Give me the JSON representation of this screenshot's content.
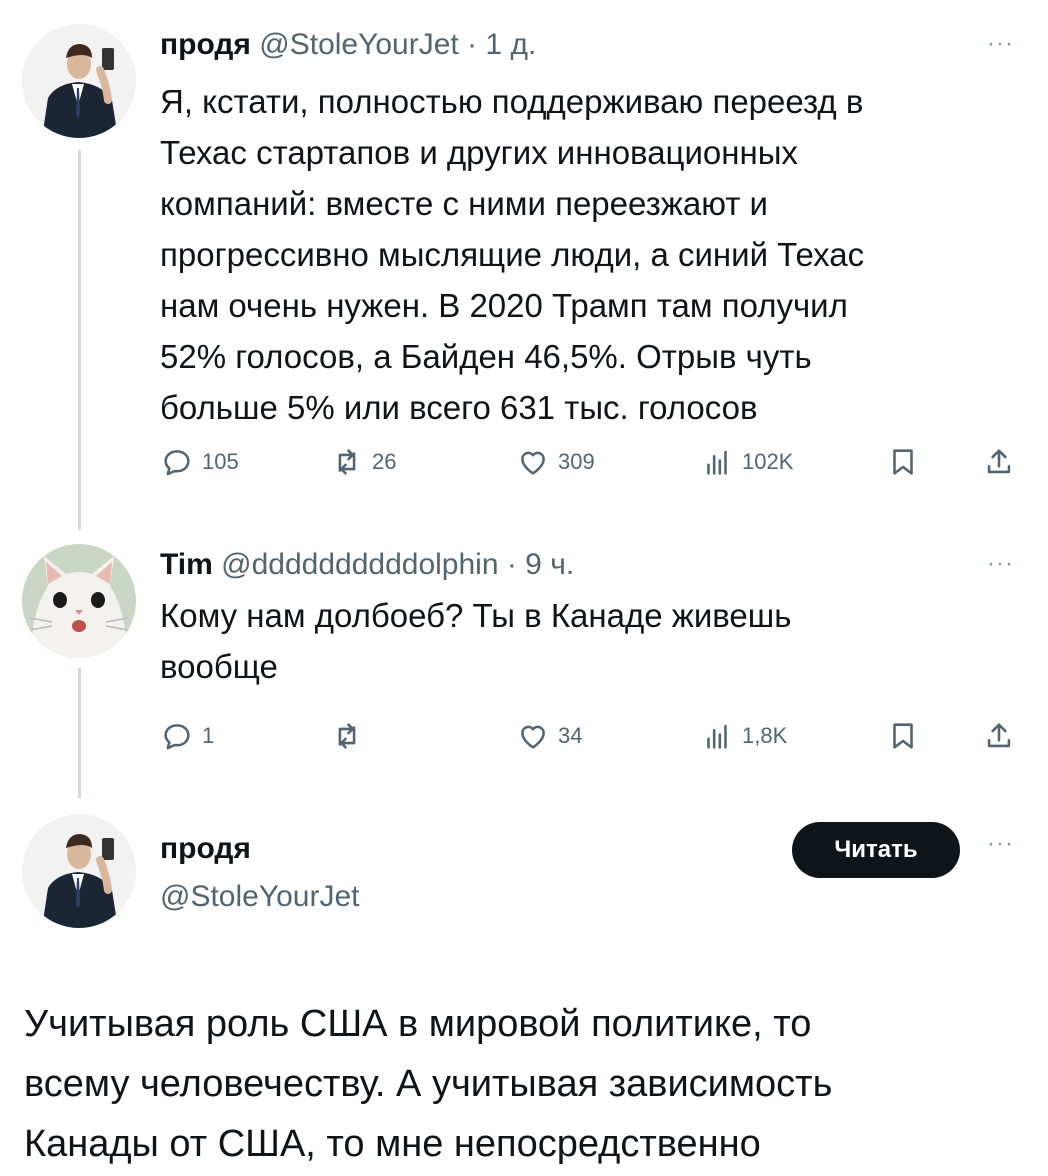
{
  "tweet1": {
    "name": "продя",
    "handle": "@StoleYourJet",
    "time": "· 1 д.",
    "more": "···",
    "lines": [
      "Я, кстати, полностью поддерживаю переезд в",
      "Техас стартапов и других инновационных",
      "компаний: вместе с ними переезжают и",
      "прогрессивно мыслящие люди, а синий Техас",
      "нам очень нужен. В 2020 Трамп там получил",
      "52% голосов, а Байден 46,5%. Отрыв чуть",
      "больше 5% или всего 631 тыс. голосов"
    ],
    "actions": {
      "replies": "105",
      "reposts": "26",
      "likes": "309",
      "views": "102K"
    },
    "avatar_icon": "person-photo-avatar"
  },
  "tweet2": {
    "name": "Tim",
    "handle": "@ddddddddddolphin",
    "time": "· 9 ч.",
    "more": "···",
    "lines": [
      "Кому нам долбоеб? Ты в Канаде живешь",
      "вообще"
    ],
    "actions": {
      "replies": "1",
      "reposts": "",
      "likes": "34",
      "views": "1,8K"
    },
    "avatar_icon": "cat-avatar"
  },
  "tweet3": {
    "name": "продя",
    "handle": "@StoleYourJet",
    "follow_label": "Читать",
    "more": "···",
    "lines": [
      "Учитывая роль США в мировой политике, то",
      "всему человечеству. А учитывая зависимость",
      "Канады от США, то мне непосредственно"
    ],
    "avatar_icon": "person-photo-avatar"
  },
  "colors": {
    "text": "#0f1419",
    "secondary": "#536471",
    "thread_line": "#cfd9de",
    "button_bg": "#0f1419"
  }
}
